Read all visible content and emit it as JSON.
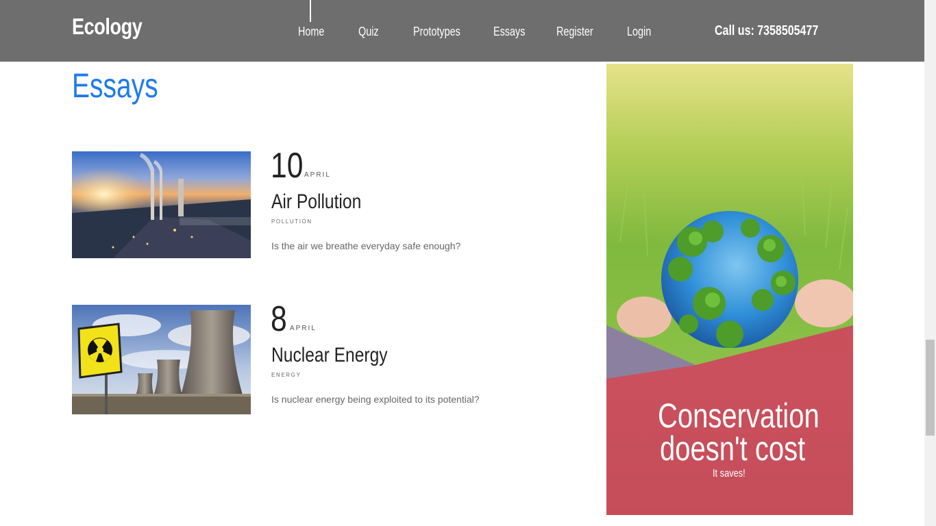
{
  "header": {
    "brand": "Ecology",
    "nav": [
      "Home",
      "Quiz",
      "Prototypes",
      "Essays",
      "Register",
      "Login"
    ],
    "phone": "Call us: 7358505477"
  },
  "page": {
    "title": "Essays"
  },
  "posts": [
    {
      "day": "10",
      "month": "APRIL",
      "title": "Air Pollution",
      "tag": "POLLUTION",
      "desc": "Is the air we breathe everyday safe enough?"
    },
    {
      "day": "8",
      "month": "APRIL",
      "title": "Nuclear Energy",
      "tag": "ENERGY",
      "desc": "Is nuclear energy being exploited to its potential?"
    }
  ],
  "ad": {
    "line1": "Conservation",
    "line2": "doesn't cost",
    "sub": "It saves!"
  },
  "colors": {
    "navbar": "#6e6e6e",
    "title": "#1f7bea",
    "ad_overlay": "#d2405f"
  }
}
